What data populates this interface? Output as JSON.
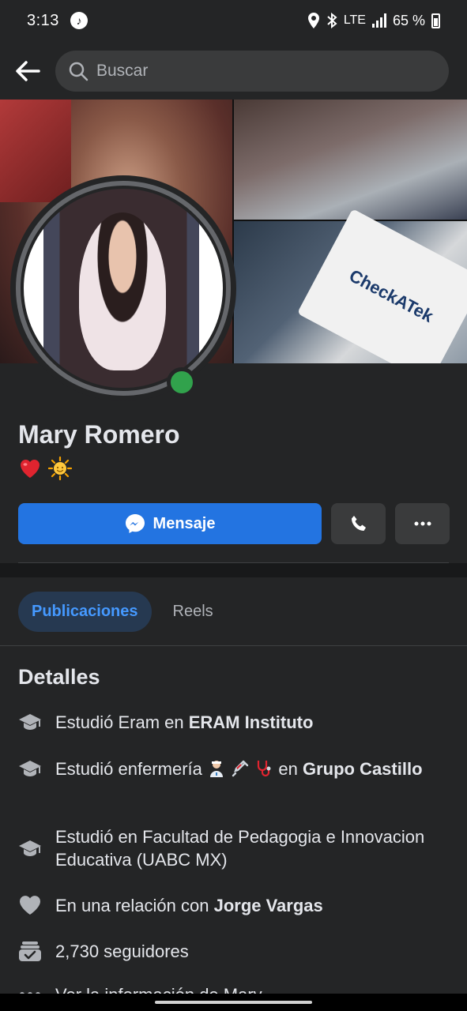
{
  "status_bar": {
    "time": "3:13",
    "network": "LTE",
    "battery_percent": "65 %"
  },
  "search": {
    "placeholder": "Buscar"
  },
  "profile": {
    "name": "Mary Romero",
    "bio_emojis": [
      "heart-emoji",
      "sun-emoji"
    ],
    "online": true
  },
  "cover": {
    "product_text": "CheckATek"
  },
  "actions": {
    "message_label": "Mensaje",
    "call_icon": "phone-icon",
    "more_icon": "more-icon"
  },
  "tabs": [
    {
      "label": "Publicaciones",
      "active": true
    },
    {
      "label": "Reels",
      "active": false
    }
  ],
  "details": {
    "title": "Detalles",
    "items": [
      {
        "icon": "graduation-cap-icon",
        "prefix": "Estudió Eram en ",
        "bold": "ERAM Instituto"
      },
      {
        "icon": "graduation-cap-icon",
        "prefix": "Estudió enfermería",
        "suffix": " en ",
        "bold": "Grupo Castillo"
      },
      {
        "icon": "graduation-cap-icon",
        "text": "Estudió en Facultad de Pedagogia e Innovacion Educativa (UABC MX)"
      },
      {
        "icon": "heart-icon",
        "prefix": "En una relación con ",
        "bold": "Jorge Vargas"
      },
      {
        "icon": "followers-icon",
        "text": "2,730 seguidores"
      },
      {
        "icon": "more-icon",
        "text": "Ver la información de Mary"
      }
    ]
  },
  "colors": {
    "background": "#242526",
    "primary": "#2374e1",
    "tab_active_bg": "#263951",
    "tab_active_text": "#4599ff",
    "online": "#31a24c"
  }
}
